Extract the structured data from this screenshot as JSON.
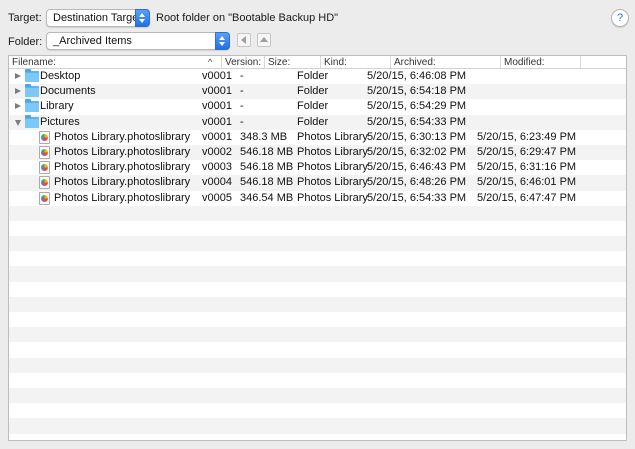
{
  "target": {
    "label": "Target:",
    "popup_value": "Destination Target",
    "description": "Root folder on \"Bootable Backup HD\""
  },
  "folder": {
    "label": "Folder:",
    "popup_value": "_Archived Items"
  },
  "help_label": "?",
  "columns": {
    "filename": "Filename:",
    "version": "Version:",
    "size": "Size:",
    "kind": "Kind:",
    "archived": "Archived:",
    "modified": "Modified:"
  },
  "sort_indicator": "^",
  "rows": [
    {
      "type": "folder",
      "expanded": false,
      "name": "Desktop",
      "version": "v0001",
      "size": "-",
      "kind": "Folder",
      "archived": "5/20/15, 6:46:08 PM",
      "modified": ""
    },
    {
      "type": "folder",
      "expanded": false,
      "name": "Documents",
      "version": "v0001",
      "size": "-",
      "kind": "Folder",
      "archived": "5/20/15, 6:54:18 PM",
      "modified": ""
    },
    {
      "type": "folder",
      "expanded": false,
      "name": "Library",
      "version": "v0001",
      "size": "-",
      "kind": "Folder",
      "archived": "5/20/15, 6:54:29 PM",
      "modified": ""
    },
    {
      "type": "folder",
      "expanded": true,
      "name": "Pictures",
      "version": "v0001",
      "size": "-",
      "kind": "Folder",
      "archived": "5/20/15, 6:54:33 PM",
      "modified": ""
    },
    {
      "type": "file",
      "name": "Photos Library.photoslibrary",
      "version": "v0001",
      "size": "348.3 MB",
      "kind": "Photos Library",
      "archived": "5/20/15, 6:30:13 PM",
      "modified": "5/20/15, 6:23:49 PM"
    },
    {
      "type": "file",
      "name": "Photos Library.photoslibrary",
      "version": "v0002",
      "size": "546.18 MB",
      "kind": "Photos Library",
      "archived": "5/20/15, 6:32:02 PM",
      "modified": "5/20/15, 6:29:47 PM"
    },
    {
      "type": "file",
      "name": "Photos Library.photoslibrary",
      "version": "v0003",
      "size": "546.18 MB",
      "kind": "Photos Library",
      "archived": "5/20/15, 6:46:43 PM",
      "modified": "5/20/15, 6:31:16 PM"
    },
    {
      "type": "file",
      "name": "Photos Library.photoslibrary",
      "version": "v0004",
      "size": "546.18 MB",
      "kind": "Photos Library",
      "archived": "5/20/15, 6:48:26 PM",
      "modified": "5/20/15, 6:46:01 PM"
    },
    {
      "type": "file",
      "name": "Photos Library.photoslibrary",
      "version": "v0005",
      "size": "346.54 MB",
      "kind": "Photos Library",
      "archived": "5/20/15, 6:54:33 PM",
      "modified": "5/20/15, 6:47:47 PM"
    }
  ],
  "icons": {
    "folder": "folder-icon",
    "file": "photos-library-icon",
    "collapsed": "disclosure-triangle-right-icon",
    "expanded": "disclosure-triangle-down-icon"
  },
  "colors": {
    "accent": "#1f6fe8",
    "folder": "#5bb4ef",
    "row_alt": "#f3f3f3"
  }
}
